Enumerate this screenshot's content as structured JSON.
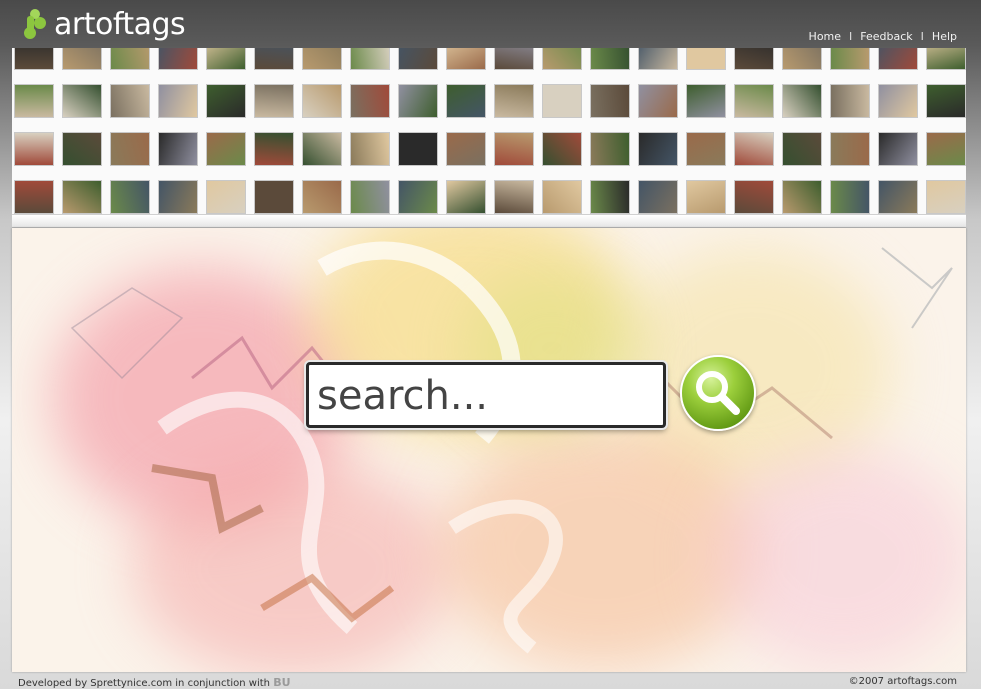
{
  "header": {
    "logo_text": "artoftags",
    "nav": [
      {
        "label": "Home"
      },
      {
        "label": "Feedback"
      },
      {
        "label": "Help"
      }
    ],
    "nav_separator": "I"
  },
  "search": {
    "placeholder": "search..."
  },
  "footer": {
    "left_text": "Developed by Sprettynice.com in conjunction with",
    "left_logo": "BU",
    "copyright": "©2007 artoftags.com"
  },
  "colors": {
    "logo_accent": "#8cc63f",
    "search_button": "#7fb51f"
  },
  "icons": [
    "logo-icon",
    "magnifier-icon"
  ]
}
